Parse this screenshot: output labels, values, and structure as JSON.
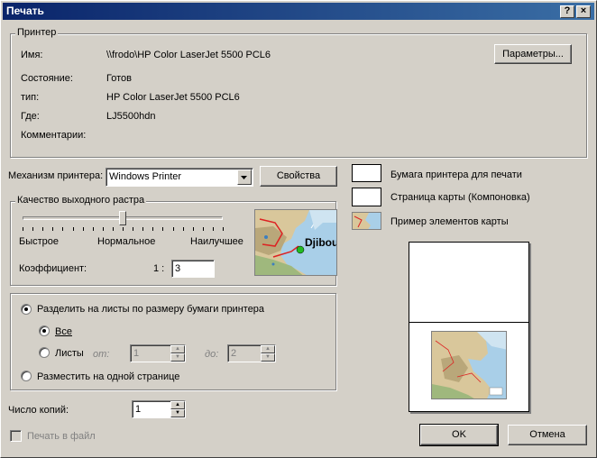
{
  "window": {
    "title": "Печать",
    "help_button": "?",
    "close_button": "×"
  },
  "printer": {
    "group_label": "Принтер",
    "name_label": "Имя:",
    "name_value": "\\\\frodo\\HP Color LaserJet 5500 PCL6",
    "status_label": "Состояние:",
    "status_value": "Готов",
    "type_label": "тип:",
    "type_value": "HP Color LaserJet 5500 PCL6",
    "where_label": "Где:",
    "where_value": "LJ5500hdn",
    "comment_label": "Комментарии:",
    "comment_value": "",
    "parameters_button": "Параметры..."
  },
  "engine": {
    "label": "Механизм принтера:",
    "selected": "Windows Printer",
    "properties_button": "Свойства"
  },
  "raster": {
    "group_label": "Качество выходного растра",
    "fast_label": "Быстрое",
    "normal_label": "Нормальное",
    "best_label": "Наилучшее",
    "slider_position": 0.5,
    "ratio_label": "Коэффициент:",
    "ratio_prefix": "1 :",
    "ratio_value": "3",
    "thumbnail_label": "Djibou"
  },
  "tiling": {
    "tile_option": "Разделить на листы по размеру бумаги принтера",
    "all_option": "Все",
    "sheets_option": "Листы",
    "from_label": "от:",
    "from_value": "1",
    "to_label": "до:",
    "to_value": "2",
    "fit_option": "Разместить на одной странице"
  },
  "copies": {
    "label": "Число копий:",
    "value": "1"
  },
  "print_to_file": {
    "label": "Печать в файл"
  },
  "legend": {
    "printer_paper": "Бумага принтера для печати",
    "map_page": "Страница карты (Компоновка)",
    "map_elements": "Пример элементов карты"
  },
  "buttons": {
    "ok": "OK",
    "cancel": "Отмена"
  }
}
